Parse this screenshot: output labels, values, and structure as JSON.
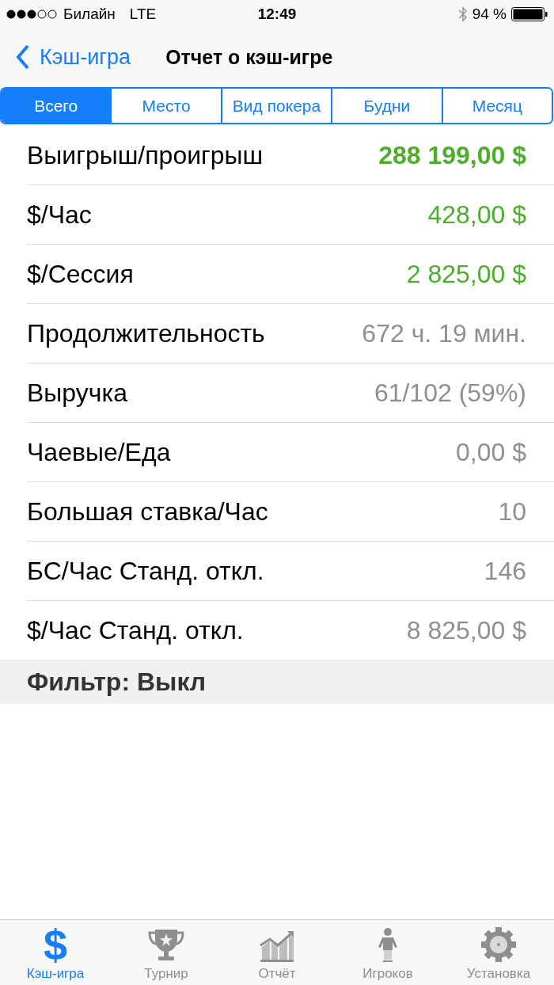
{
  "status_bar": {
    "carrier": "Билайн",
    "network": "LTE",
    "time": "12:49",
    "battery": "94 %"
  },
  "nav": {
    "back": "Кэш-игра",
    "title": "Отчет о кэш-игре"
  },
  "segments": [
    {
      "label": "Всего",
      "selected": true
    },
    {
      "label": "Место",
      "selected": false
    },
    {
      "label": "Вид покера",
      "selected": false
    },
    {
      "label": "Будни",
      "selected": false
    },
    {
      "label": "Месяц",
      "selected": false
    }
  ],
  "rows": [
    {
      "label": "Выигрыш/проигрыш",
      "value": "288 199,00 $",
      "color": "#4cae2a",
      "bold": true
    },
    {
      "label": "$/Час",
      "value": "428,00 $",
      "color": "#4cae2a",
      "bold": false
    },
    {
      "label": "$/Сессия",
      "value": "2 825,00 $",
      "color": "#4cae2a",
      "bold": false
    },
    {
      "label": "Продолжительность",
      "value": "672 ч. 19 мин.",
      "color": "#8e8e93",
      "bold": false
    },
    {
      "label": "Выручка",
      "value": "61/102 (59%)",
      "color": "#8e8e93",
      "bold": false
    },
    {
      "label": "Чаевые/Еда",
      "value": "0,00 $",
      "color": "#8e8e93",
      "bold": false
    },
    {
      "label": "Большая ставка/Час",
      "value": "10",
      "color": "#8e8e93",
      "bold": false
    },
    {
      "label": "БС/Час Станд. откл.",
      "value": "146",
      "color": "#8e8e93",
      "bold": false
    },
    {
      "label": "$/Час Станд. откл.",
      "value": "8 825,00 $",
      "color": "#8e8e93",
      "bold": false
    }
  ],
  "filter": "Фильтр: Выкл",
  "tab_bar": [
    {
      "kind": "dollar",
      "glyph": "$",
      "label": "Кэш-игра",
      "selected": true
    },
    {
      "kind": "trophy",
      "label": "Турнир",
      "selected": false
    },
    {
      "kind": "chart",
      "label": "Отчёт",
      "selected": false
    },
    {
      "kind": "person",
      "label": "Игроков",
      "selected": false
    },
    {
      "kind": "gear",
      "label": "Установка",
      "selected": false
    }
  ]
}
